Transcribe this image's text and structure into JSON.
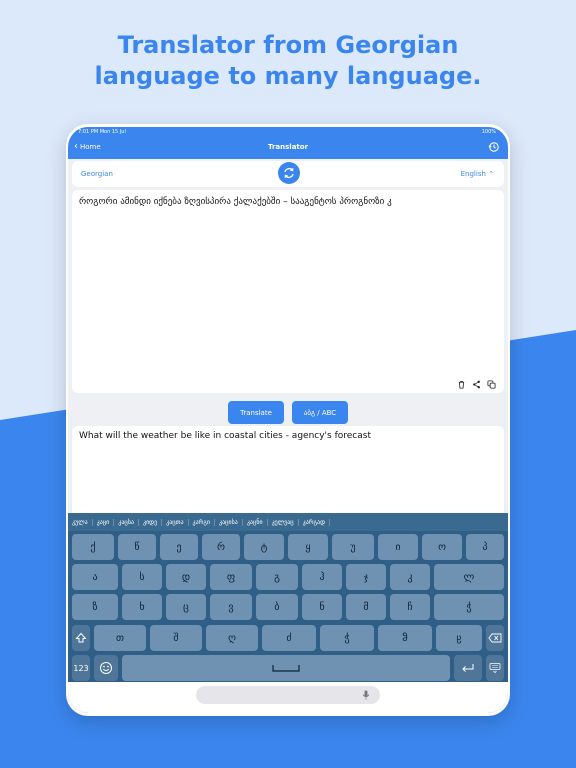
{
  "headline": {
    "line1": "Translator from Georgian",
    "line2": "language to many language."
  },
  "status_bar": {
    "time": "7:01 PM  Mon 15 Jul",
    "battery": "100%"
  },
  "nav": {
    "back_label": "Home",
    "title": "Translator",
    "history_icon": "history-icon"
  },
  "language_bar": {
    "source": "Georgian",
    "target": "English ⌃",
    "swap_icon": "swap-refresh-icon"
  },
  "input": {
    "text": "როგორი ამინდი იქნება ზღვისპირა ქალაქებში – სააგენტოს პროგნოზი კ"
  },
  "input_actions": [
    "trash-icon",
    "share-icon",
    "copy-icon"
  ],
  "buttons": {
    "translate": "Translate",
    "keyboard_switch": "აბგ / ABC"
  },
  "output": {
    "text": "What will the weather be like in coastal cities - agency's forecast"
  },
  "keyboard": {
    "suggestions": [
      "კულა",
      "კაცი",
      "კაცსა",
      "კიდე",
      "კაცთა",
      "კარგი",
      "კაცისა",
      "კაცნი",
      "კელვაც",
      "კარგად"
    ],
    "row1": [
      "ქ",
      "წ",
      "ე",
      "რ",
      "ტ",
      "ყ",
      "უ",
      "ი",
      "ო",
      "პ"
    ],
    "row2": [
      "ა",
      "ს",
      "დ",
      "ფ",
      "გ",
      "ჰ",
      "ჯ",
      "კ",
      "ლ"
    ],
    "row3": [
      "ზ",
      "ხ",
      "ც",
      "ვ",
      "ბ",
      "ნ",
      "მ",
      "ჩ",
      "ჭ"
    ],
    "row4": [
      "თ",
      "შ",
      "ღ",
      "ძ",
      "ჭ",
      "ჵ",
      "ჸ"
    ],
    "numbers_key": "123"
  },
  "colors": {
    "accent": "#3b86ee",
    "keyboard_bg": "#2f5f86",
    "key_bg": "#6f92b2"
  }
}
